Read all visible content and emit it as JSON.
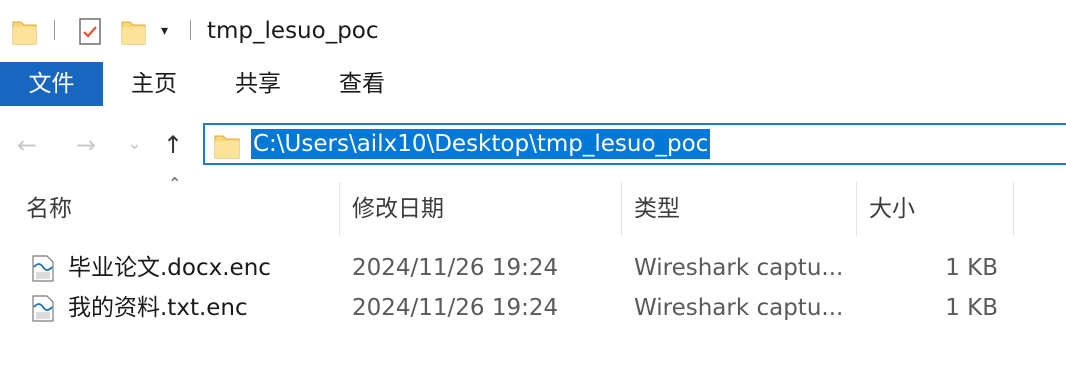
{
  "window": {
    "title": "tmp_lesuo_poc"
  },
  "quick_access": {
    "dropdown_glyph": "▾"
  },
  "ribbon": {
    "tabs": [
      "文件",
      "主页",
      "共享",
      "查看"
    ]
  },
  "nav": {
    "back_glyph": "←",
    "forward_glyph": "→",
    "recent_glyph": "⌄",
    "up_glyph": "↑"
  },
  "address_bar": {
    "path": "C:\\Users\\ailx10\\Desktop\\tmp_lesuo_poc"
  },
  "columns": {
    "name": "名称",
    "date": "修改日期",
    "type": "类型",
    "size": "大小",
    "sort_glyph": "⌃"
  },
  "files": [
    {
      "name": "毕业论文.docx.enc",
      "date": "2024/11/26 19:24",
      "type": "Wireshark captu...",
      "size": "1 KB",
      "icon": "wireshark-capture-file-icon"
    },
    {
      "name": "我的资料.txt.enc",
      "date": "2024/11/26 19:24",
      "type": "Wireshark captu...",
      "size": "1 KB",
      "icon": "wireshark-capture-file-icon"
    }
  ],
  "colors": {
    "accent": "#1766c0",
    "selection": "#0078d7",
    "folder": "#f8d775"
  }
}
